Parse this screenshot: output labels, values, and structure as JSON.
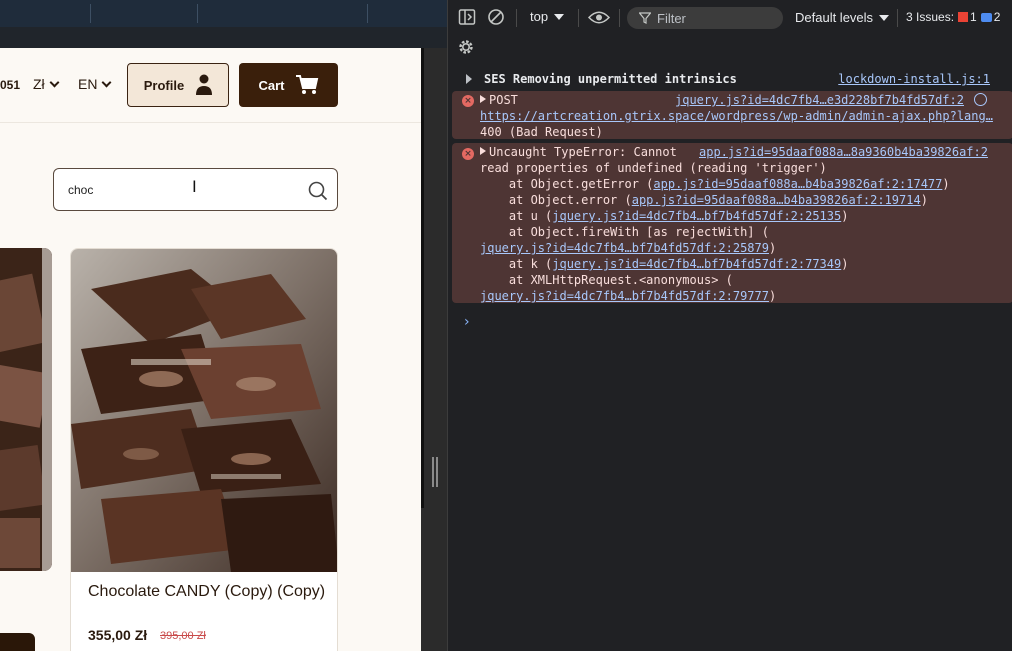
{
  "site": {
    "nav_fragment": "051",
    "currency": "Zł",
    "language": "EN",
    "profile_label": "Profile",
    "cart_label": "Cart",
    "search": {
      "value": "choc",
      "placeholder": ""
    },
    "product": {
      "title": "Chocolate CANDY (Copy) (Copy)",
      "price": "355,00 Zł",
      "old_price": "395,00 Zł"
    }
  },
  "devtools": {
    "context": "top",
    "filter_placeholder": "Filter",
    "levels": "Default levels",
    "issues_label": "3 Issues:",
    "issues_errors": "1",
    "issues_messages": "2",
    "messages": {
      "info": {
        "text": "SES Removing unpermitted intrinsics",
        "source": "lockdown-install.js:1"
      },
      "post": {
        "method": "POST",
        "source": "jquery.js?id=4dc7fb4…e3d228bf7b4fd57df:2",
        "url": "https://artcreation.gtrix.space/wordpress/wp-admin/admin-ajax.php?lang…",
        "status": "400 (Bad Request)"
      },
      "typeerror": {
        "head": "Uncaught TypeError: Cannot",
        "source": "app.js?id=95daaf088a…8a9360b4ba39826af:2",
        "line2": "read properties of undefined (reading 'trigger')",
        "s1_pre": "    at Object.getError (",
        "s1_link": "app.js?id=95daaf088a…b4ba39826af:2:17477",
        "s1_post": ")",
        "s2_pre": "    at Object.error (",
        "s2_link": "app.js?id=95daaf088a…b4ba39826af:2:19714",
        "s2_post": ")",
        "s3_pre": "    at u (",
        "s3_link": "jquery.js?id=4dc7fb4…bf7b4fd57df:2:25135",
        "s3_post": ")",
        "s4": "    at Object.fireWith [as rejectWith] (",
        "s4_link": "jquery.js?id=4dc7fb4…bf7b4fd57df:2:25879",
        "s4_post": ")",
        "s5_pre": "    at k (",
        "s5_link": "jquery.js?id=4dc7fb4…bf7b4fd57df:2:77349",
        "s5_post": ")",
        "s6": "    at XMLHttpRequest.<anonymous> (",
        "s6_link": "jquery.js?id=4dc7fb4…bf7b4fd57df:2:79777",
        "s6_post": ")"
      }
    }
  }
}
